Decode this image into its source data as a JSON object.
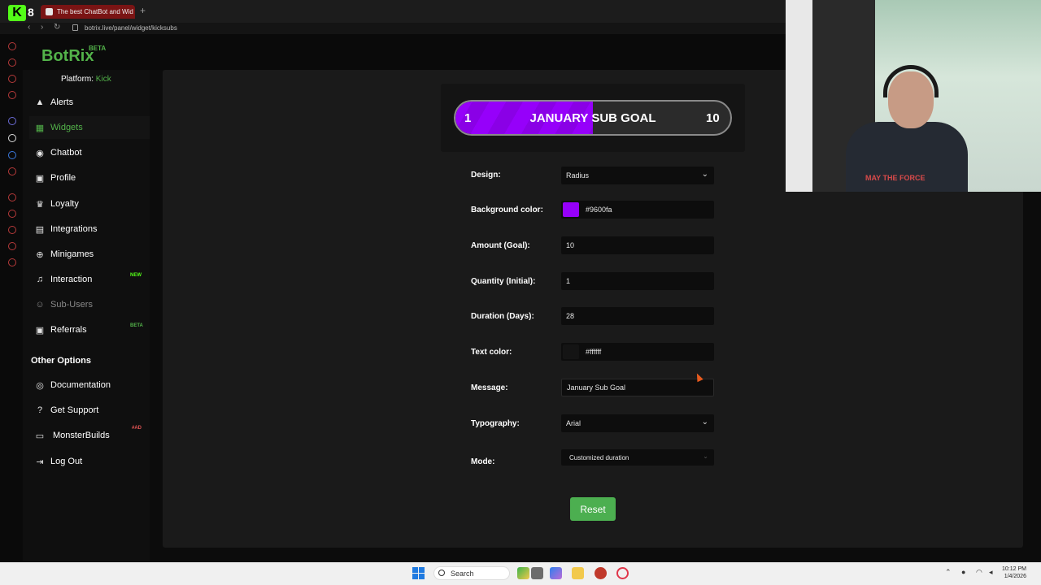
{
  "browser": {
    "kick_number": "8",
    "tab_title": "The best ChatBot and Wid",
    "url": "botrix.live/panel/widget/kicksubs"
  },
  "app": {
    "brand": "BotRix",
    "brand_badge": "BETA",
    "platform_label": "Platform:",
    "platform_value": "Kick"
  },
  "sidebar": {
    "items": [
      {
        "label": "Alerts",
        "icon": "alert-icon"
      },
      {
        "label": "Widgets",
        "icon": "widgets-icon",
        "active": true
      },
      {
        "label": "Chatbot",
        "icon": "robot-icon"
      },
      {
        "label": "Profile",
        "icon": "profile-icon"
      },
      {
        "label": "Loyalty",
        "icon": "trophy-icon"
      },
      {
        "label": "Integrations",
        "icon": "integrations-icon"
      },
      {
        "label": "Minigames",
        "icon": "gamepad-icon"
      },
      {
        "label": "Interaction",
        "icon": "music-icon",
        "badge": "NEW"
      },
      {
        "label": "Sub-Users",
        "icon": "users-icon"
      },
      {
        "label": "Referrals",
        "icon": "referrals-icon",
        "badge": "BETA"
      }
    ],
    "other_title": "Other Options",
    "other_items": [
      {
        "label": "Documentation",
        "icon": "docs-icon"
      },
      {
        "label": "Get Support",
        "icon": "help-icon"
      },
      {
        "label": "MonsterBuilds",
        "icon": "laptop-icon",
        "badge": "#AD"
      },
      {
        "label": "Log Out",
        "icon": "logout-icon"
      }
    ]
  },
  "preview": {
    "start": "1",
    "title": "JANUARY SUB GOAL",
    "end": "10",
    "progress": 0.5,
    "fill_color": "#9600fa"
  },
  "form": {
    "design_label": "Design:",
    "design_value": "Radius",
    "bg_label": "Background color:",
    "bg_value": "#9600fa",
    "amount_label": "Amount (Goal):",
    "amount_value": "10",
    "quantity_label": "Quantity (Initial):",
    "quantity_value": "1",
    "duration_label": "Duration (Days):",
    "duration_value": "28",
    "textcolor_label": "Text color:",
    "textcolor_value": "#ffffff",
    "message_label": "Message:",
    "message_value": "January Sub Goal",
    "typography_label": "Typography:",
    "typography_value": "Arial",
    "mode_label": "Mode:",
    "mode_value": "Customized duration",
    "reset_label": "Reset"
  },
  "webcam": {
    "shirt_text": "MAY THE FORCE"
  },
  "taskbar": {
    "search_label": "Search",
    "time": "10:12 PM",
    "date": "1/4/2026"
  },
  "colors": {
    "accent": "#53b34a",
    "kick_green": "#53fc18",
    "reset_button": "#4caf50"
  }
}
